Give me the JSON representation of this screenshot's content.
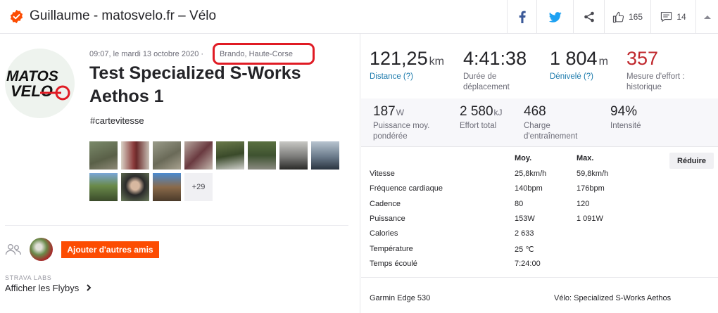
{
  "header": {
    "title": "Guillaume - matosvelo.fr – Vélo",
    "kudos_count": "165",
    "comments_count": "14"
  },
  "activity": {
    "meta": "09:07, le mardi 13 octobre 2020 ·",
    "location": "Brando, Haute-Corse",
    "title": "Test Specialized S-Works Aethos 1",
    "hashtag": "#cartevitesse",
    "more_photos": "+29",
    "logo_text_top": "MATOS",
    "logo_text_bottom": "VELO"
  },
  "social": {
    "add_friends": "Ajouter d'autres amis",
    "labs": "STRAVA LABS",
    "flyby": "Afficher les Flybys"
  },
  "stats": {
    "distance": {
      "value": "121,25",
      "unit": "km",
      "label": "Distance (?)"
    },
    "moving_time": {
      "value": "4:41:38",
      "label1": "Durée de",
      "label2": "déplacement"
    },
    "elevation": {
      "value": "1 804",
      "unit": "m",
      "label": "Dénivelé (?)"
    },
    "effort": {
      "value": "357",
      "label1": "Mesure d'effort :",
      "label2": "historique"
    },
    "weighted_power": {
      "value": "187",
      "unit": "W",
      "label1": "Puissance moy.",
      "label2": "pondérée"
    },
    "total_work": {
      "value": "2 580",
      "unit": "kJ",
      "label": "Effort total"
    },
    "training_load": {
      "value": "468",
      "label1": "Charge",
      "label2": "d'entraînement"
    },
    "intensity": {
      "value": "94%",
      "label": "Intensité"
    }
  },
  "table": {
    "reduce_label": "Réduire",
    "col_avg": "Moy.",
    "col_max": "Max.",
    "rows": [
      {
        "label": "Vitesse",
        "avg": "25,8km/h",
        "max": "59,8km/h"
      },
      {
        "label": "Fréquence cardiaque",
        "avg": "140bpm",
        "max": "176bpm"
      },
      {
        "label": "Cadence",
        "avg": "80",
        "max": "120"
      },
      {
        "label": "Puissance",
        "avg": "153W",
        "max": "1 091W"
      },
      {
        "label": "Calories",
        "avg": "2 633",
        "max": ""
      },
      {
        "label": "Température",
        "avg": "25 ℃",
        "max": ""
      },
      {
        "label": "Temps écoulé",
        "avg": "7:24:00",
        "max": ""
      }
    ]
  },
  "equipment": {
    "device": "Garmin Edge 530",
    "bike": "Vélo: Specialized S-Works Aethos"
  },
  "colors": {
    "accent": "#fc4c02",
    "link": "#1c7aac",
    "effort": "#c0282d"
  }
}
